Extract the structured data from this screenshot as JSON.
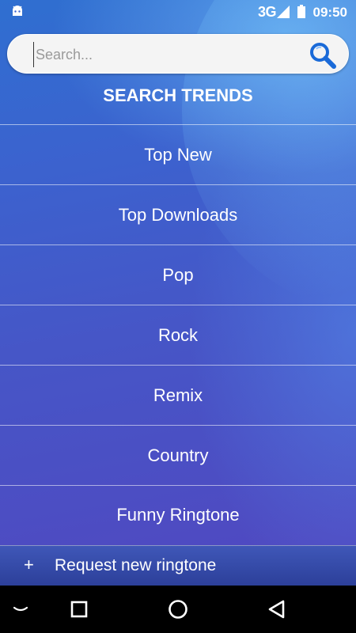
{
  "status_bar": {
    "network": "3G",
    "time": "09:50",
    "icons": [
      "android-icon",
      "signal-icon",
      "battery-icon"
    ]
  },
  "search": {
    "placeholder": "Search...",
    "value": "",
    "icon": "search-icon"
  },
  "section_title": "SEARCH TRENDS",
  "trends": [
    {
      "label": "Top New"
    },
    {
      "label": "Top Downloads"
    },
    {
      "label": "Pop"
    },
    {
      "label": "Rock"
    },
    {
      "label": "Remix"
    },
    {
      "label": "Country"
    },
    {
      "label": "Funny Ringtone"
    }
  ],
  "request": {
    "icon_text": "+",
    "label": "Request new ringtone"
  },
  "nav": {
    "icons": [
      "keyboard-hide-icon",
      "recents-icon",
      "home-icon",
      "back-icon"
    ]
  },
  "colors": {
    "accent_search": "#1a6ad8",
    "text": "#ffffff"
  }
}
